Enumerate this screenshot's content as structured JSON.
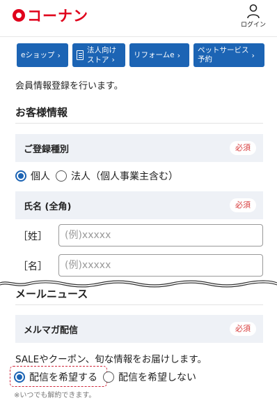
{
  "header": {
    "logo_text": "コーナン",
    "login_label": "ログイン"
  },
  "nav": [
    {
      "label": "eショップ",
      "chevron": "›"
    },
    {
      "line1": "法人向け",
      "line2": "ストア",
      "chevron": "›"
    },
    {
      "label": "リフォームe",
      "chevron": "›"
    },
    {
      "line1": "ペットサービス",
      "line2": "予約",
      "chevron": "›"
    }
  ],
  "intro": "会員情報登録を行います。",
  "customer_section": {
    "title": "お客様情報",
    "registration_type": {
      "label": "ご登録種別",
      "required": "必須",
      "options": [
        "個人",
        "法人（個人事業主含む）"
      ],
      "selected": "個人"
    },
    "name": {
      "label": "氏名 (全角)",
      "required": "必須",
      "last_label": "［姓］",
      "last_placeholder": "(例)xxxxx",
      "first_label": "［名］",
      "first_placeholder": "(例)xxxxx"
    }
  },
  "mail_section": {
    "title": "メールニュース",
    "magazine": {
      "label": "メルマガ配信",
      "required": "必須",
      "description": "SALEやクーポン、旬な情報をお届けします。",
      "options": [
        "配信を希望する",
        "配信を希望しない"
      ],
      "selected": "配信を希望する",
      "note": "※いつでも解約できます。"
    }
  },
  "colors": {
    "brand_red": "#e0001b",
    "nav_blue": "#1c64b4",
    "row_bg": "#eef1f6",
    "required_text": "#d73a3a"
  }
}
